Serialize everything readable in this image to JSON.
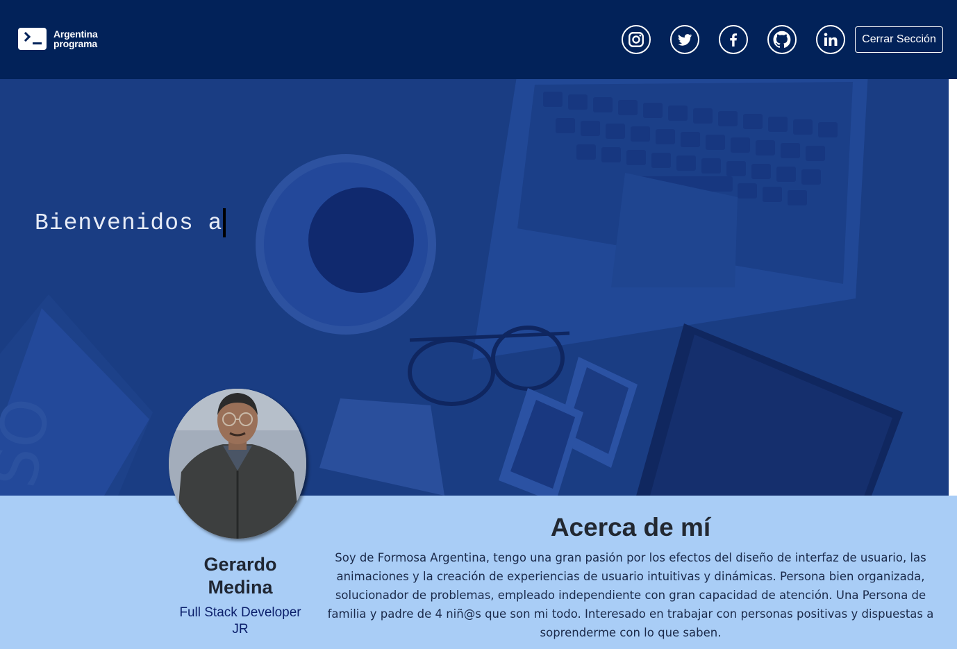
{
  "navbar": {
    "brand": {
      "line1": "Argentina",
      "line2": "programa",
      "icon": "terminal-prompt-icon"
    },
    "social": [
      {
        "name": "Instagram",
        "icon": "instagram-icon"
      },
      {
        "name": "Twitter",
        "icon": "twitter-icon"
      },
      {
        "name": "Facebook",
        "icon": "facebook-icon"
      },
      {
        "name": "GitHub",
        "icon": "github-icon"
      },
      {
        "name": "LinkedIn",
        "icon": "linkedin-icon"
      }
    ],
    "logout_label": "Cerrar Sección"
  },
  "hero": {
    "typed_text": "Bienvenidos a",
    "background": "desk-with-laptop-coffee-glasses-photo"
  },
  "profile": {
    "name_line1": "Gerardo",
    "name_line2": "Medina",
    "role_line1": "Full Stack Developer",
    "role_line2": "JR"
  },
  "about": {
    "title": "Acerca de mí",
    "text": "Soy de Formosa Argentina, tengo una gran pasión por los efectos del diseño de interfaz de usuario, las animaciones y la creación de experiencias de usuario intuitivas y dinámicas. Persona bien organizada, solucionador de problemas, empleado independiente con gran capacidad de atención. Una Persona de familia y padre de 4 niñ@s que son mi todo. Interesado en trabajar con personas positivas y dispuestas a soprenderme con lo que saben."
  },
  "colors": {
    "navbar": "#022259",
    "hero_overlay": "#183b81",
    "about_background": "#a9cdf6",
    "role_text": "#0b1f6b"
  }
}
